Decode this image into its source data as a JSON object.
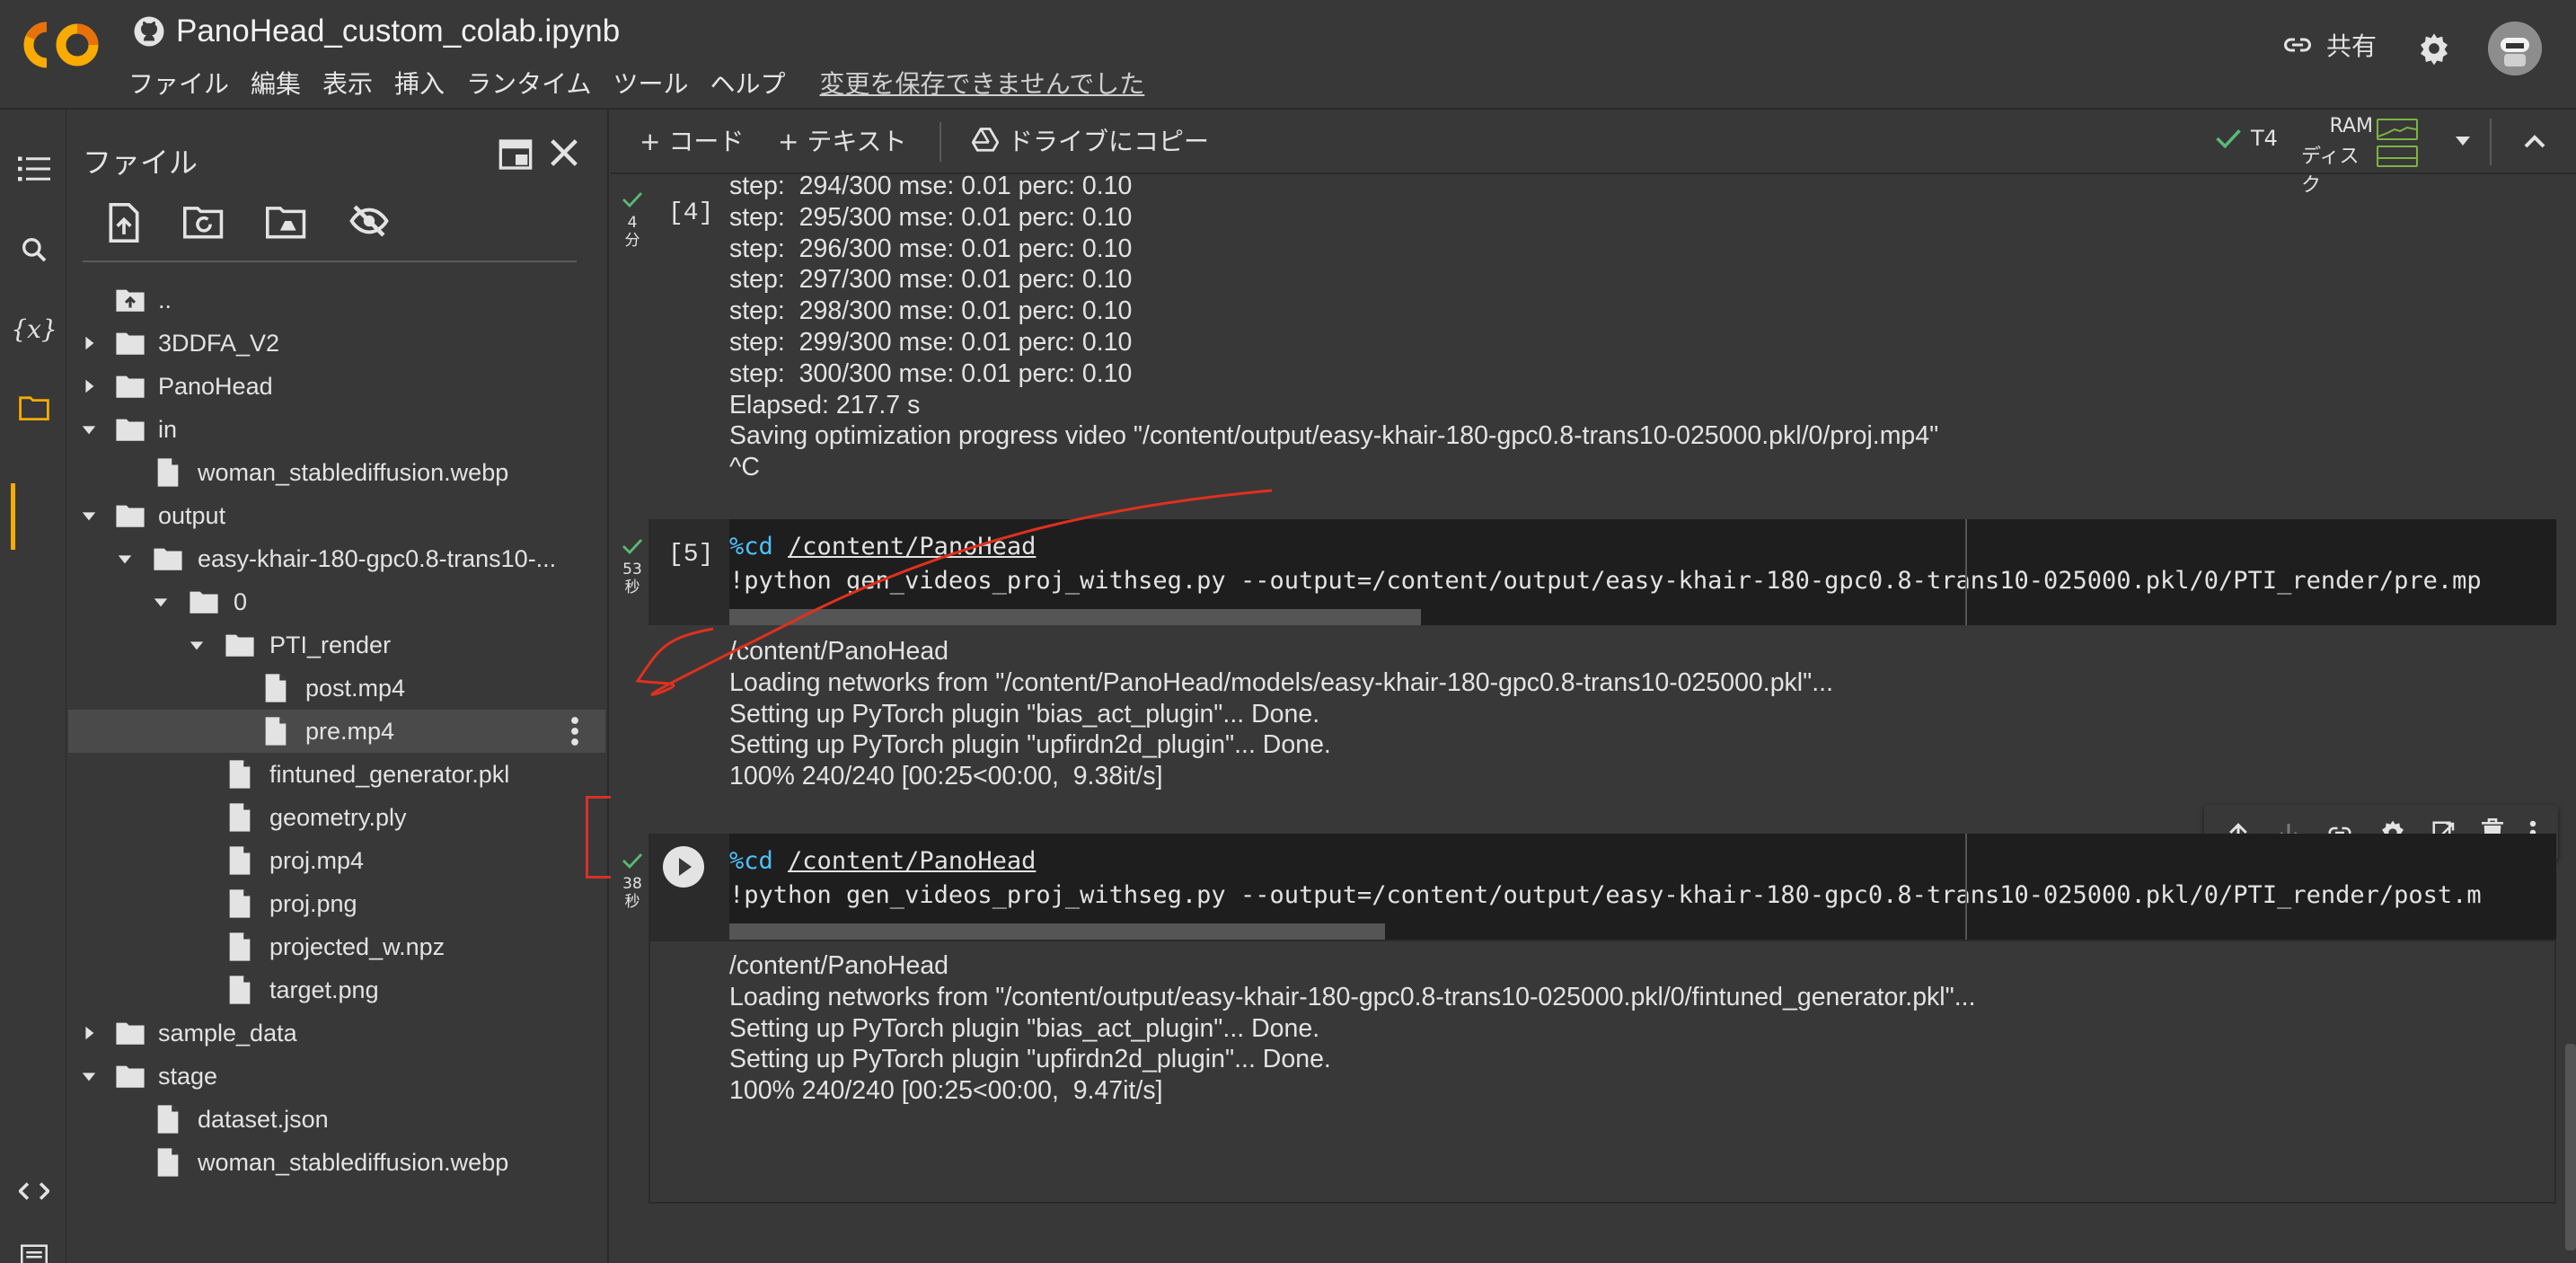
{
  "app": {
    "title": "PanoHead_custom_colab.ipynb",
    "menu": [
      "ファイル",
      "編集",
      "表示",
      "挿入",
      "ランタイム",
      "ツール",
      "ヘルプ"
    ],
    "unsaved_notice": "変更を保存できませんでした",
    "share_label": "共有",
    "brand_colors": {
      "logo": "#f9ab00",
      "accent_orange": "#e8710a"
    }
  },
  "filepanel": {
    "title": "ファイル",
    "tree": [
      {
        "label": "..",
        "type": "up",
        "depth": 0
      },
      {
        "label": "3DDFA_V2",
        "type": "folder",
        "depth": 0,
        "expanded": false
      },
      {
        "label": "PanoHead",
        "type": "folder",
        "depth": 0,
        "expanded": false
      },
      {
        "label": "in",
        "type": "folder",
        "depth": 0,
        "expanded": true
      },
      {
        "label": "woman_stablediffusion.webp",
        "type": "file",
        "depth": 1
      },
      {
        "label": "output",
        "type": "folder",
        "depth": 0,
        "expanded": true
      },
      {
        "label": "easy-khair-180-gpc0.8-trans10-...",
        "type": "folder",
        "depth": 1,
        "expanded": true
      },
      {
        "label": "0",
        "type": "folder",
        "depth": 2,
        "expanded": true
      },
      {
        "label": "PTI_render",
        "type": "folder",
        "depth": 3,
        "expanded": true
      },
      {
        "label": "post.mp4",
        "type": "file",
        "depth": 4
      },
      {
        "label": "pre.mp4",
        "type": "file",
        "depth": 4,
        "selected": true
      },
      {
        "label": "fintuned_generator.pkl",
        "type": "file",
        "depth": 3
      },
      {
        "label": "geometry.ply",
        "type": "file",
        "depth": 3
      },
      {
        "label": "proj.mp4",
        "type": "file",
        "depth": 3
      },
      {
        "label": "proj.png",
        "type": "file",
        "depth": 3
      },
      {
        "label": "projected_w.npz",
        "type": "file",
        "depth": 3
      },
      {
        "label": "target.png",
        "type": "file",
        "depth": 3
      },
      {
        "label": "sample_data",
        "type": "folder",
        "depth": 0,
        "expanded": false
      },
      {
        "label": "stage",
        "type": "folder",
        "depth": 0,
        "expanded": true
      },
      {
        "label": "dataset.json",
        "type": "file",
        "depth": 1
      },
      {
        "label": "woman_stablediffusion.webp",
        "type": "file",
        "depth": 1
      }
    ]
  },
  "toolbar": {
    "add_code": "+ コード",
    "add_text": "+ テキスト",
    "copy_drive": "ドライブにコピー",
    "runtime": "T4",
    "ram_label": "RAM",
    "disk_label": "ディスク"
  },
  "cells": [
    {
      "number": "[4]",
      "exec_time": [
        "4",
        "分"
      ],
      "output": [
        "step:  294/300 mse: 0.01 perc: 0.10",
        "step:  295/300 mse: 0.01 perc: 0.10",
        "step:  296/300 mse: 0.01 perc: 0.10",
        "step:  297/300 mse: 0.01 perc: 0.10",
        "step:  298/300 mse: 0.01 perc: 0.10",
        "step:  299/300 mse: 0.01 perc: 0.10",
        "step:  300/300 mse: 0.01 perc: 0.10",
        "Elapsed: 217.7 s",
        "Saving optimization progress video \"/content/output/easy-khair-180-gpc0.8-trans10-025000.pkl/0/proj.mp4\"",
        "^C"
      ]
    },
    {
      "number": "[5]",
      "exec_time": [
        "53",
        "秒"
      ],
      "code_line1_magic": "%cd",
      "code_line1_path": "/content/PanoHead",
      "code_line2": "!python gen_videos_proj_withseg.py --output=/content/output/easy-khair-180-gpc0.8-trans10-025000.pkl/0/PTI_render/pre.mp",
      "output": [
        "/content/PanoHead",
        "Loading networks from \"/content/PanoHead/models/easy-khair-180-gpc0.8-trans10-025000.pkl\"...",
        "Setting up PyTorch plugin \"bias_act_plugin\"... Done.",
        "Setting up PyTorch plugin \"upfirdn2d_plugin\"... Done.",
        "100% 240/240 [00:25<00:00,  9.38it/s]"
      ]
    },
    {
      "number": "",
      "exec_time": [
        "38",
        "秒"
      ],
      "code_line1_magic": "%cd",
      "code_line1_path": "/content/PanoHead",
      "code_line2": "!python gen_videos_proj_withseg.py --output=/content/output/easy-khair-180-gpc0.8-trans10-025000.pkl/0/PTI_render/post.m",
      "output": [
        "/content/PanoHead",
        "Loading networks from \"/content/output/easy-khair-180-gpc0.8-trans10-025000.pkl/0/fintuned_generator.pkl\"...",
        "Setting up PyTorch plugin \"bias_act_plugin\"... Done.",
        "Setting up PyTorch plugin \"upfirdn2d_plugin\"... Done.",
        "100% 240/240 [00:25<00:00,  9.47it/s]"
      ]
    }
  ]
}
